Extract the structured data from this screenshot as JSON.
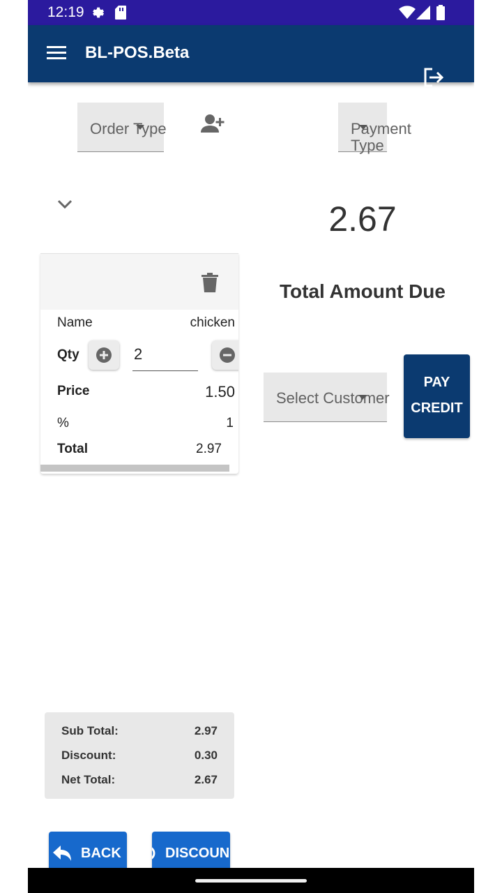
{
  "status_bar": {
    "time": "12:19"
  },
  "app_bar": {
    "title": "BL-POS.Beta"
  },
  "order_type": {
    "placeholder": "Order Type"
  },
  "payment_type": {
    "placeholder_line1": "Payment",
    "placeholder_line2": "Type"
  },
  "amount_due": {
    "value": "2.67",
    "label": "Total Amount Due"
  },
  "item": {
    "name_label": "Name",
    "name_value": "chicken",
    "qty_label": "Qty",
    "qty_value": "2",
    "price_label": "Price",
    "price_value": "1.50",
    "percent_label": "%",
    "percent_value": "1",
    "total_label": "Total",
    "total_value": "2.97"
  },
  "customer": {
    "placeholder": "Select Customer"
  },
  "pay_credit": {
    "line1": "PAY",
    "line2": "CREDIT"
  },
  "totals": {
    "sub_total_label": "Sub Total:",
    "sub_total_value": "2.97",
    "discount_label": "Discount:",
    "discount_value": "0.30",
    "net_total_label": "Net Total:",
    "net_total_value": "2.67"
  },
  "actions": {
    "back_label": "BACK",
    "discount_label": "DISCOUN"
  },
  "colors": {
    "status_bar": "#2b1a9e",
    "app_bar": "#0b3a70",
    "action_button": "#1769cc"
  }
}
